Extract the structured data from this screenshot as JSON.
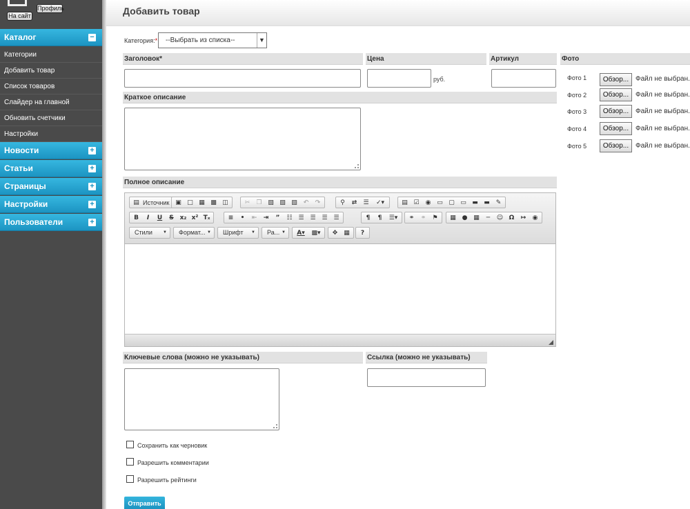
{
  "topbar": {
    "site_button": "На сайт",
    "profile_button": "Профиль"
  },
  "sidebar": {
    "catalog": {
      "label": "Каталог",
      "toggle": "−",
      "items": [
        "Категории",
        "Добавить товар",
        "Список товаров",
        "Слайдер на главной",
        "Обновить счетчики",
        "Настройки"
      ]
    },
    "sections": [
      {
        "label": "Новости",
        "toggle": "+"
      },
      {
        "label": "Статьи",
        "toggle": "+"
      },
      {
        "label": "Страницы",
        "toggle": "+"
      },
      {
        "label": "Настройки",
        "toggle": "+"
      },
      {
        "label": "Пользователи",
        "toggle": "+"
      }
    ]
  },
  "page": {
    "title": "Добавить товар"
  },
  "form": {
    "category_label": "Категория:",
    "required_mark": "*",
    "category_value": "--Выбрать из списка--",
    "title_label": "Заголовок*",
    "price_label": "Цена",
    "price_unit": "руб.",
    "sku_label": "Артикул",
    "photo_label": "Фото",
    "photos": [
      {
        "label": "Фото 1",
        "button": "Обзор...",
        "status": "Файл не выбран."
      },
      {
        "label": "Фото 2",
        "button": "Обзор...",
        "status": "Файл не выбран."
      },
      {
        "label": "Фото 3",
        "button": "Обзор...",
        "status": "Файл не выбран."
      },
      {
        "label": "Фото 4",
        "button": "Обзор...",
        "status": "Файл не выбран."
      },
      {
        "label": "Фото 5",
        "button": "Обзор...",
        "status": "Файл не выбран."
      }
    ],
    "short_desc_label": "Краткое описание",
    "full_desc_label": "Полное описание",
    "keywords_label": "Ключевые слова (можно не указывать)",
    "link_label": "Ссылка (можно не указывать)",
    "checkboxes": [
      "Сохранить как черновик",
      "Разрешить комментарии",
      "Разрешить рейтинги"
    ],
    "submit": "Отправить"
  },
  "editor": {
    "source_label": "Источник",
    "combos": [
      "Стили",
      "Формат...",
      "Шрифт",
      "Ра..."
    ],
    "icons": [
      "source-icon",
      "save-icon",
      "new-page-icon",
      "preview-icon",
      "print-icon",
      "templates-icon",
      "cut-icon",
      "copy-icon",
      "paste-icon",
      "paste-text-icon",
      "paste-word-icon",
      "undo-icon",
      "redo-icon",
      "find-icon",
      "replace-icon",
      "select-all-icon",
      "spellcheck-icon",
      "form-icon",
      "checkbox-icon",
      "radio-icon",
      "textfield-icon",
      "textarea-icon",
      "select-icon",
      "button-icon",
      "image-button-icon",
      "hidden-field-icon",
      "bold-icon",
      "italic-icon",
      "underline-icon",
      "strike-icon",
      "subscript-icon",
      "superscript-icon",
      "remove-format-icon",
      "numbered-list-icon",
      "bulleted-list-icon",
      "outdent-icon",
      "indent-icon",
      "blockquote-icon",
      "div-icon",
      "align-left-icon",
      "align-center-icon",
      "align-right-icon",
      "justify-icon",
      "ltr-icon",
      "rtl-icon",
      "language-icon",
      "link-icon",
      "unlink-icon",
      "anchor-icon",
      "image-icon",
      "flash-icon",
      "table-icon",
      "hr-icon",
      "smiley-icon",
      "special-char-icon",
      "page-break-icon",
      "iframe-icon",
      "text-color-icon",
      "bg-color-icon",
      "maximize-icon",
      "show-blocks-icon",
      "help-icon"
    ]
  }
}
